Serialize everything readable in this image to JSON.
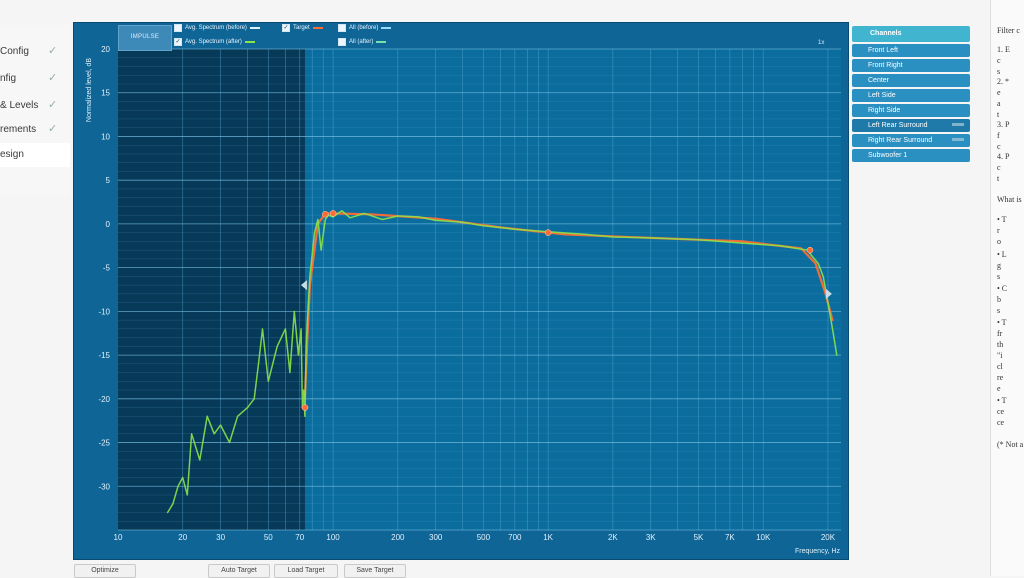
{
  "left_nav": {
    "items": [
      {
        "label": "Config",
        "checked": true
      },
      {
        "label": "nfig",
        "checked": true
      },
      {
        "label": "& Levels",
        "checked": true
      },
      {
        "label": "rements",
        "checked": true
      },
      {
        "label": "esign",
        "checked": false
      }
    ]
  },
  "panel": {
    "impulse_label": "IMPULSE",
    "zoom_label": "1x",
    "checkboxes": [
      {
        "label": "Avg. Spectrum (before)",
        "checked": false,
        "color": "#d9f4ff"
      },
      {
        "label": "Target",
        "checked": true,
        "color": "#ff6b35"
      },
      {
        "label": "All (before)",
        "checked": false,
        "color": "#96d8ff"
      },
      {
        "label": "Avg. Spectrum (after)",
        "checked": true,
        "color": "#89e34a"
      },
      {
        "label": "All (after)",
        "checked": false,
        "color": "#74e2a9"
      }
    ]
  },
  "chart_data": {
    "type": "line",
    "ylabel": "Normalized level, dB",
    "xlabel": "Frequency, Hz",
    "xscale": "log",
    "xlim": [
      10,
      23000
    ],
    "ylim": [
      -35,
      20
    ],
    "yticks": [
      20,
      15,
      10,
      5,
      0,
      -5,
      -10,
      -15,
      -20,
      -25,
      -30
    ],
    "xticks": [
      10,
      20,
      30,
      50,
      70,
      100,
      200,
      300,
      500,
      700,
      1000,
      2000,
      3000,
      5000,
      7000,
      10000,
      20000
    ],
    "xtick_labels": [
      "10",
      "20",
      "30",
      "50",
      "70",
      "100",
      "200",
      "300",
      "500",
      "700",
      "1K",
      "2K",
      "3K",
      "5K",
      "7K",
      "10K",
      "20K"
    ],
    "series": [
      {
        "name": "Target",
        "color": "#ff6b35",
        "x": [
          74,
          76,
          78,
          85,
          92,
          100,
          150,
          300,
          600,
          1200,
          3000,
          8000,
          15000,
          17500,
          19500,
          21000
        ],
        "y": [
          -20,
          -13,
          -7,
          0,
          1.2,
          1.2,
          1.1,
          0.6,
          -0.4,
          -1.2,
          -1.6,
          -2,
          -2.8,
          -4.5,
          -8,
          -11
        ]
      },
      {
        "name": "Avg. Spectrum (after)",
        "color": "#89e34a",
        "x": [
          17,
          18,
          19,
          20,
          21,
          22,
          24,
          26,
          28,
          30,
          33,
          36,
          40,
          43,
          45,
          47,
          50,
          55,
          60,
          63,
          66,
          69,
          71,
          72,
          73,
          74,
          75,
          76,
          78,
          82,
          85,
          88,
          92,
          95,
          100,
          110,
          120,
          140,
          170,
          200,
          250,
          300,
          400,
          500,
          700,
          1000,
          1500,
          2000,
          3000,
          5000,
          8000,
          12000,
          16000,
          18000,
          19000,
          20000,
          21000,
          22000
        ],
        "y": [
          -33,
          -32,
          -30,
          -29,
          -31,
          -24,
          -27,
          -22,
          -24,
          -23,
          -25,
          -22,
          -21,
          -20,
          -16,
          -12,
          -18,
          -14,
          -12,
          -17,
          -10,
          -15,
          -12,
          -21,
          -19,
          -22,
          -14,
          -11,
          -6,
          -1,
          0.5,
          -3,
          0.5,
          1,
          0.8,
          1.5,
          0.7,
          1.2,
          0.5,
          0.9,
          0.8,
          0.4,
          0.2,
          -0.2,
          -0.6,
          -0.9,
          -1.2,
          -1.5,
          -1.6,
          -1.8,
          -2.2,
          -2.5,
          -3,
          -4.5,
          -6,
          -9,
          -12,
          -15
        ]
      }
    ],
    "points": {
      "name": "Target",
      "x": [
        74,
        92,
        100,
        1000,
        16500
      ],
      "y": [
        -21,
        1.1,
        1.2,
        -1,
        -3
      ]
    }
  },
  "channels": {
    "header": "Channels",
    "items": [
      {
        "label": "Front Left",
        "selected": false,
        "tag": false
      },
      {
        "label": "Front Right",
        "selected": false,
        "tag": false
      },
      {
        "label": "Center",
        "selected": false,
        "tag": false
      },
      {
        "label": "Left Side",
        "selected": false,
        "tag": false
      },
      {
        "label": "Right Side",
        "selected": false,
        "tag": false
      },
      {
        "label": "Left Rear Surround",
        "selected": true,
        "tag": true
      },
      {
        "label": "Right Rear Surround",
        "selected": false,
        "tag": true
      },
      {
        "label": "Subwoofer 1",
        "selected": false,
        "tag": false
      }
    ]
  },
  "doc": {
    "lines": [
      "Filter c",
      "1. E",
      "c",
      "s",
      "2. *",
      "e",
      "a",
      "t",
      "3. P",
      "f",
      "c",
      "4. P",
      "c",
      "t",
      "What is",
      "• T",
      "r",
      "o",
      "• L",
      "g",
      "s",
      "• C",
      "b",
      "s",
      "• T",
      "fr",
      "th",
      "\"i",
      "cl",
      "re",
      "e",
      "• T",
      "ce",
      "ce",
      "(* Not a"
    ]
  },
  "buttons": {
    "optimize": "Optimize",
    "auto_target": "Auto Target",
    "load_target": "Load Target",
    "save_target": "Save Target"
  }
}
